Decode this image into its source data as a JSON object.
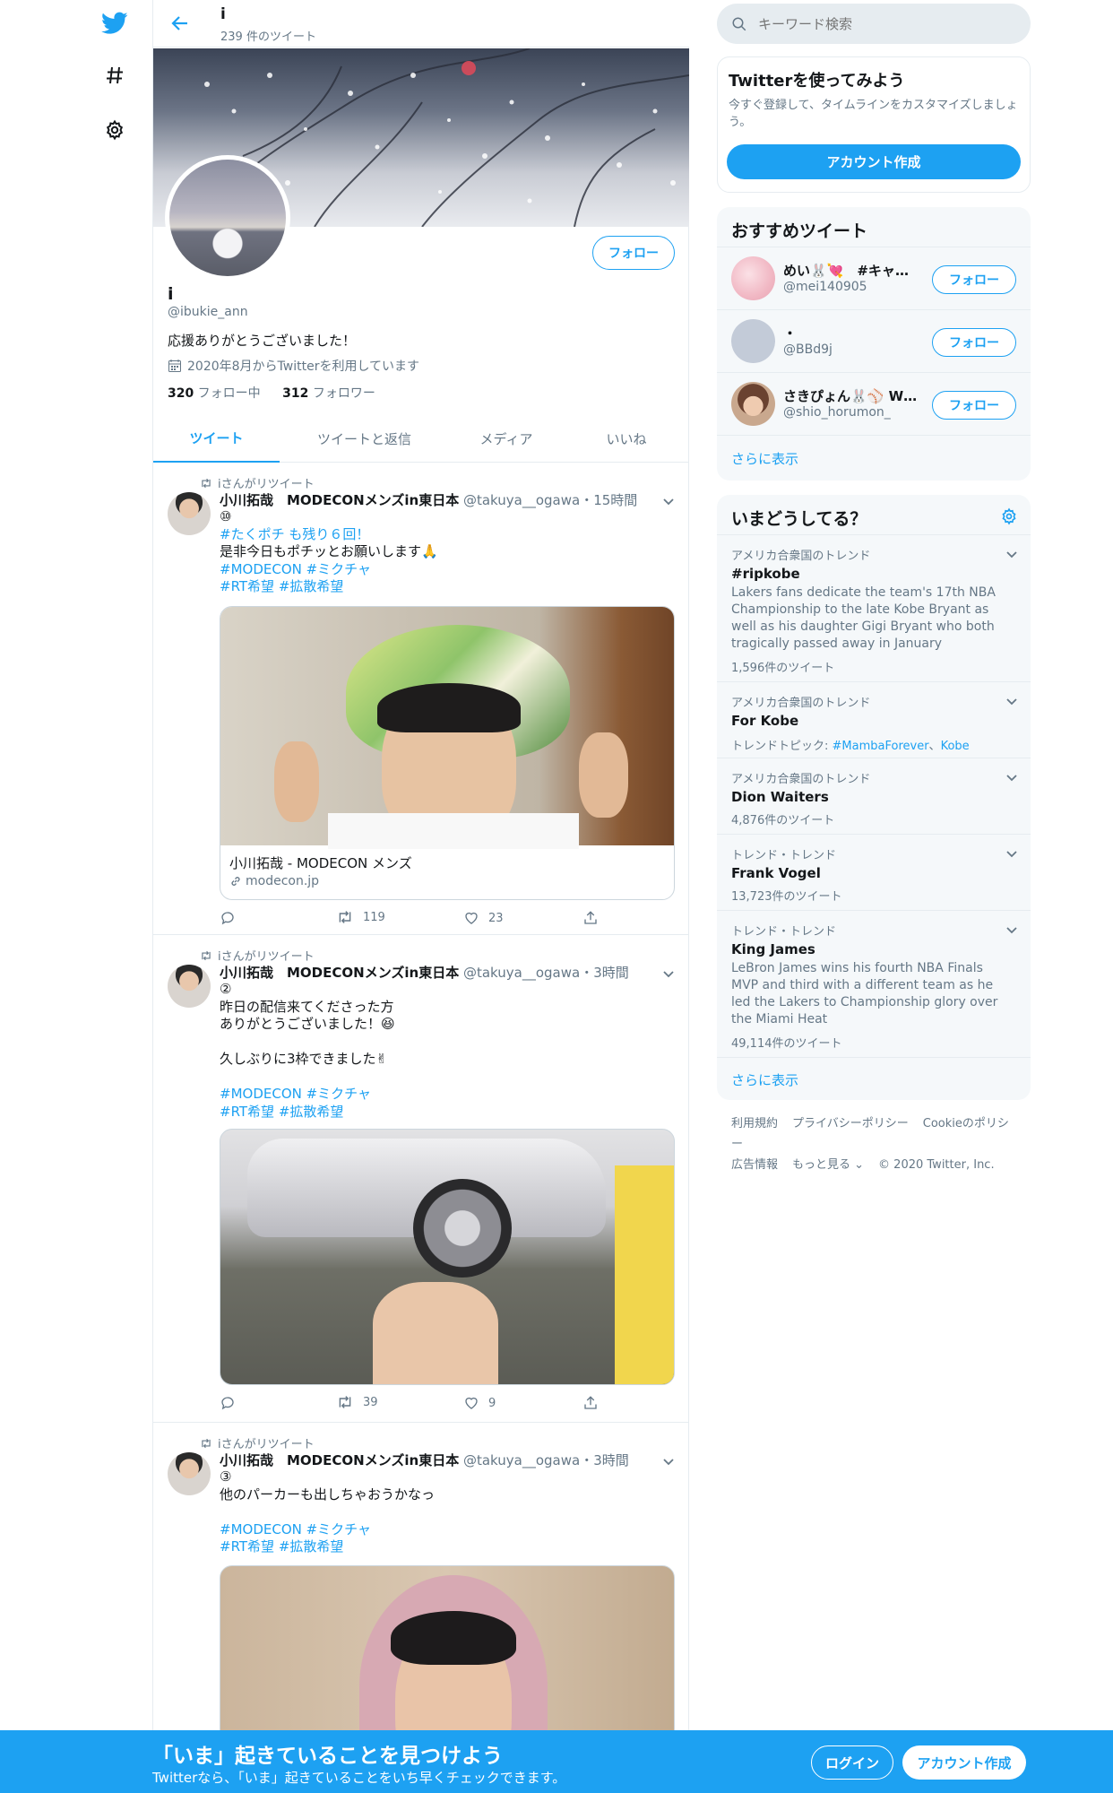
{
  "header": {
    "name": "i",
    "tweet_count": "239 件のツイート"
  },
  "profile": {
    "name": "i",
    "handle": "@ibukie_ann",
    "bio": "応援ありがとうございました！",
    "joined": "2020年8月からTwitterを利用しています",
    "following_count": "320",
    "following_label": " フォロー中",
    "followers_count": "312",
    "followers_label": " フォロワー",
    "follow_label": "フォロー"
  },
  "tabs": [
    "ツイート",
    "ツイートと返信",
    "メディア",
    "いいね"
  ],
  "tweets": [
    {
      "rt_label": "iさんがリツイート",
      "name": "小川拓哉　MODECONメンズin東日本",
      "meta": " @takuya__ogawa・15時間",
      "lines": [
        "⑩",
        "#たくポチ も残り６回！",
        "是非今日もポチッとお願いします🙏",
        "#MODECON #ミクチャ",
        "#RT希望 #拡散希望"
      ],
      "card_title": "小川拓哉 - MODECON メンズ",
      "card_domain": "modecon.jp",
      "retweets": "119",
      "likes": "23"
    },
    {
      "rt_label": "iさんがリツイート",
      "name": "小川拓哉　MODECONメンズin東日本",
      "meta": " @takuya__ogawa・3時間",
      "lines": [
        "②",
        "昨日の配信来てくださった方",
        "ありがとうございました！😆",
        "",
        "久しぶりに3枠できました✌",
        "",
        "#MODECON #ミクチャ",
        "#RT希望 #拡散希望"
      ],
      "retweets": "39",
      "likes": "9"
    },
    {
      "rt_label": "iさんがリツイート",
      "name": "小川拓哉　MODECONメンズin東日本",
      "meta": " @takuya__ogawa・3時間",
      "lines": [
        "③",
        "他のパーカーも出しちゃおうかなっ",
        "",
        "#MODECON #ミクチャ",
        "#RT希望 #拡散希望"
      ]
    }
  ],
  "sidebar": {
    "search_placeholder": "キーワード検索",
    "signup_card": {
      "title": "Twitterを使ってみよう",
      "desc1": "今すぐ登録して、タイムラインをカスタマイズしましょ",
      "desc2": "う。",
      "button": "アカウント作成"
    },
    "recommend": {
      "title": "おすすめツイート",
      "users": [
        {
          "name": "めい🐰💘　#キャン…",
          "handle": "@mei140905",
          "follow": "フォロー"
        },
        {
          "name": "・",
          "handle": "@BBd9j",
          "follow": "フォロー"
        },
        {
          "name": "さきぴょん🐰⚾ WE…",
          "handle": "@shio_horumon_",
          "follow": "フォロー"
        }
      ],
      "more": "さらに表示"
    },
    "trends": {
      "title": "いまどうしてる？",
      "items": [
        {
          "context": "アメリカ合衆国のトレンド",
          "title": "#ripkobe",
          "desc": "Lakers fans dedicate the team's 17th NBA Championship to the late Kobe Bryant as well as his daughter Gigi Bryant who both tragically passed away in January",
          "count": "1,596件のツイート"
        },
        {
          "context": "アメリカ合衆国のトレンド",
          "title": "For Kobe",
          "topic_label": "トレンドトピック: ",
          "topic_1": "#MambaForever",
          "topic_sep": "、",
          "topic_2": "Kobe"
        },
        {
          "context": "アメリカ合衆国のトレンド",
          "title": "Dion Waiters",
          "count": "4,876件のツイート"
        },
        {
          "context": "トレンド・トレンド",
          "title": "Frank Vogel",
          "count": "13,723件のツイート"
        },
        {
          "context": "トレンド・トレンド",
          "title": "King James",
          "desc": "LeBron James wins his fourth NBA Finals MVP and third with a different team as he led the Lakers to Championship glory over the Miami Heat",
          "count": "49,114件のツイート"
        }
      ],
      "more": "さらに表示"
    },
    "footer": {
      "terms": "利用規約",
      "privacy": "プライバシーポリシー",
      "cookie": "Cookieのポリシー",
      "ads": "広告情報",
      "more": "もっと見る ⌄",
      "copyright": "© 2020 Twitter, Inc."
    }
  },
  "bottom_bar": {
    "title": "「いま」起きていることを見つけよう",
    "subtitle": "Twitterなら、「いま」起きていることをいち早くチェックできます。",
    "login": "ログイン",
    "signup": "アカウント作成"
  },
  "colors": {
    "accent": "#1da1f2",
    "text": "#14171a",
    "muted": "#657786",
    "card_bg": "#f5f8fa"
  }
}
